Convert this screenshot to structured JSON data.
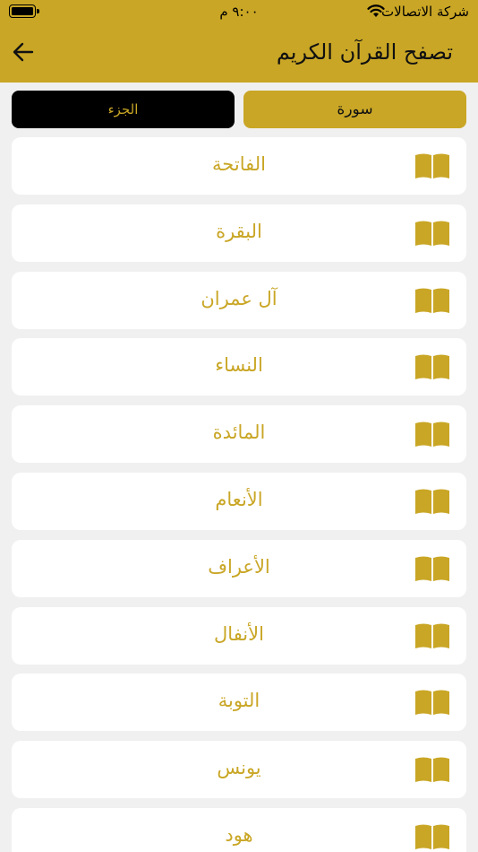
{
  "status": {
    "carrier": "شركة الاتصالات",
    "time": "٩:٠٠ م"
  },
  "header": {
    "title": "تصفح القرآن الكريم",
    "back_icon": "arrow-left-icon"
  },
  "tabs": {
    "surah_label": "سورة",
    "juz_label": "الجزء",
    "selected": "سورة"
  },
  "colors": {
    "accent": "#c9a625",
    "background": "#f0f0f0",
    "card": "#ffffff",
    "dark_tab": "#000000"
  },
  "surahs": [
    {
      "name": "الفاتحة",
      "icon": "open-book-icon"
    },
    {
      "name": "البقرة",
      "icon": "open-book-icon"
    },
    {
      "name": "آل عمران",
      "icon": "open-book-icon"
    },
    {
      "name": "النساء",
      "icon": "open-book-icon"
    },
    {
      "name": "المائدة",
      "icon": "open-book-icon"
    },
    {
      "name": "الأنعام",
      "icon": "open-book-icon"
    },
    {
      "name": "الأعراف",
      "icon": "open-book-icon"
    },
    {
      "name": "الأنفال",
      "icon": "open-book-icon"
    },
    {
      "name": "التوبة",
      "icon": "open-book-icon"
    },
    {
      "name": "يونس",
      "icon": "open-book-icon"
    },
    {
      "name": "هود",
      "icon": "open-book-icon"
    }
  ]
}
